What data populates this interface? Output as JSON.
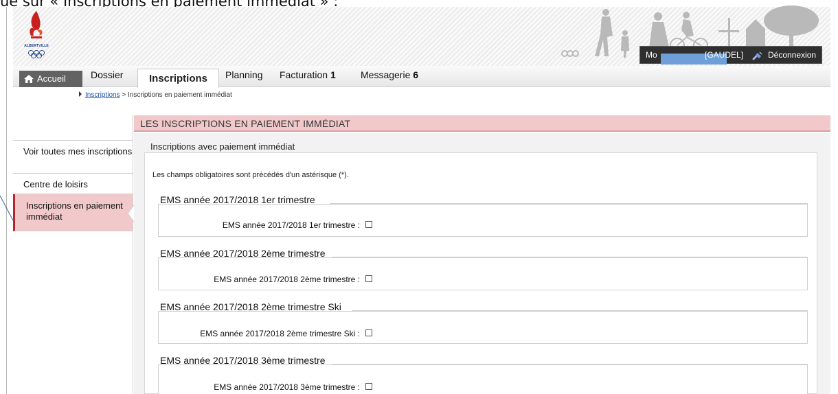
{
  "caption": "ue sur « Inscriptions en paiement immédiat » :",
  "header": {
    "user_prefix": "Mo",
    "user_name": "[GAUDEL]",
    "logout_label": "Déconnexion",
    "logo_text": "ALBERTVILLE"
  },
  "nav": {
    "home_label": "Accueil",
    "items": [
      {
        "label": "Dossier",
        "badge": ""
      },
      {
        "label": "Inscriptions",
        "badge": ""
      },
      {
        "label": "Planning",
        "badge": ""
      },
      {
        "label": "Facturation",
        "badge": "1"
      },
      {
        "label": "Messagerie",
        "badge": "6"
      }
    ],
    "active_index": 1
  },
  "breadcrumb": {
    "link": "Inscriptions",
    "separator": ">",
    "current": "Inscriptions en paiement immédiat"
  },
  "sidebar": {
    "items": [
      {
        "label": "Voir toutes mes inscriptions",
        "active": false
      },
      {
        "label": "Centre de loisirs",
        "active": false
      },
      {
        "label": "Inscriptions en paiement immédiat",
        "active": true
      }
    ]
  },
  "main": {
    "section_title": "LES INSCRIPTIONS EN PAIEMENT IMMÉDIAT",
    "panel_title": "Inscriptions avec paiement immédiat",
    "required_note": "Les champs obligatoires sont précédés d'un astérisque (*).",
    "groups": [
      {
        "legend": "EMS année 2017/2018 1er trimestre",
        "field_label": "EMS année 2017/2018 1er trimestre :",
        "checked": false
      },
      {
        "legend": "EMS année 2017/2018 2ème trimestre",
        "field_label": "EMS année 2017/2018 2ème trimestre :",
        "checked": false
      },
      {
        "legend": "EMS année 2017/2018 2ème trimestre Ski",
        "field_label": "EMS année 2017/2018 2ème trimestre Ski :",
        "checked": false
      },
      {
        "legend": "EMS année 2017/2018 3ème trimestre",
        "field_label": "EMS année 2017/2018 3ème trimestre :",
        "checked": false
      }
    ]
  },
  "colors": {
    "accent_pink": "#f1c9cb",
    "accent_red": "#b3262d",
    "link_blue": "#1f52a3",
    "redaction_blue": "#6f9fd8"
  }
}
